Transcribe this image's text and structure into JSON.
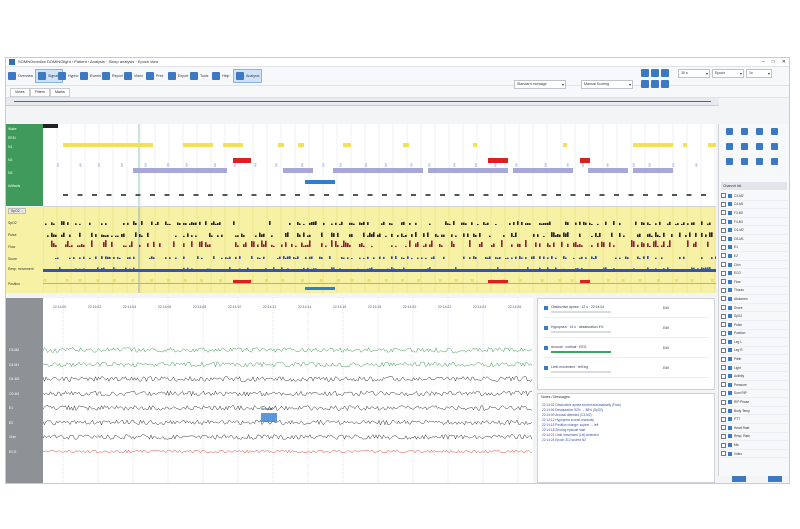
{
  "window": {
    "title": "SOMNOmedics DOMINOlight › Patient › Analysis · Sleep analysis · Epoch view",
    "controls": [
      "–",
      "□",
      "✕"
    ]
  },
  "toolbar": {
    "buttons": [
      {
        "label": "Overview",
        "icon": "grid-icon"
      },
      {
        "label": "Signals",
        "icon": "waveform-icon"
      },
      {
        "label": "Hypno",
        "icon": "hypnogram-icon"
      },
      {
        "label": "Events",
        "icon": "flag-icon"
      },
      {
        "label": "Report",
        "icon": "document-icon"
      },
      {
        "label": "Video",
        "icon": "camera-icon"
      },
      {
        "label": "Print",
        "icon": "printer-icon"
      },
      {
        "label": "Export",
        "icon": "export-icon"
      },
      {
        "label": "Tools",
        "icon": "wrench-icon"
      },
      {
        "label": "Help",
        "icon": "help-icon"
      },
      {
        "label": "Analysis",
        "icon": "chart-icon"
      }
    ],
    "dropdown_left": "Standard montage",
    "dropdown_right": "Manual Scoring",
    "right_fields": [
      "30 s",
      "Epoch",
      "1x"
    ]
  },
  "subbar": {
    "tabs": [
      "Views",
      "Filters",
      "Marks"
    ]
  },
  "hypnogram": {
    "labels": [
      "Wake",
      "REM",
      "N1",
      "N2",
      "N3",
      "Artifacts"
    ],
    "colors": {
      "yellow": "#f1e15a",
      "red": "#d92121",
      "lavender": "#a7a8d8",
      "blue": "#2f7fd1",
      "green": "#3fa45f"
    }
  },
  "mid": {
    "label_button": "SpO2 ...",
    "labels": [
      "SpO2",
      "Pulse",
      "Flow",
      "Snore",
      "Resp. movement",
      "Position"
    ]
  },
  "eeg": {
    "channels": [
      "C3-M2",
      "C4-M1",
      "O1-M2",
      "O2-M1",
      "E1",
      "E2",
      "Chin",
      "ECG"
    ],
    "times": [
      "22:14:00",
      "22:14:02",
      "22:14:04",
      "22:14:06",
      "22:14:08",
      "22:14:10",
      "22:14:12",
      "22:14:14",
      "22:14:16",
      "22:14:18",
      "22:14:20",
      "22:14:22",
      "22:14:24",
      "22:14:26"
    ],
    "marker": "Arousal"
  },
  "events_panel": {
    "rows": [
      {
        "text": "Obstructive apnea · 12 s · 22:14:04",
        "sub": "Edit"
      },
      {
        "text": "Hypopnea · 14 s · desaturation 4%",
        "sub": "Edit"
      },
      {
        "text": "Arousal · cortical · EEG",
        "sub": "Edit"
      },
      {
        "text": "Limb movement · left leg",
        "sub": "Edit"
      }
    ]
  },
  "messages": {
    "header": "Notes / Messages",
    "lines": [
      "22:14:02  Obstructive apnea scored automatically  (Flow)",
      "22:14:06  Desaturation 92% → 88%  (SpO2)",
      "22:14:09  Arousal detected  (C3-M2)",
      "22:14:12  Hypopnea scored manually",
      "22:14:15  Position change: supine → left",
      "22:14:18  Snoring episode start",
      "22:14:21  Limb movement (LM) detected",
      "22:14:24  Epoch 312 scored N2"
    ]
  },
  "right_panel": {
    "header": "Channel list",
    "channels": [
      "C3-M2",
      "C4-M1",
      "F3-M2",
      "F4-M1",
      "O1-M2",
      "O2-M1",
      "E1",
      "E2",
      "Chin",
      "ECG",
      "Flow",
      "Thorax",
      "Abdomen",
      "Snore",
      "SpO2",
      "Pulse",
      "Position",
      "Leg L",
      "Leg R",
      "Pleth",
      "Light",
      "Activity",
      "Pressure",
      "Sum RIP",
      "RIP Phase",
      "Body Temp",
      "PTT",
      "Heart Rate",
      "Resp. Rate",
      "Mic",
      "Video",
      "Marker",
      "CO2",
      "Arousal idx",
      "Desat idx"
    ]
  },
  "statusbar": {
    "text": ""
  }
}
